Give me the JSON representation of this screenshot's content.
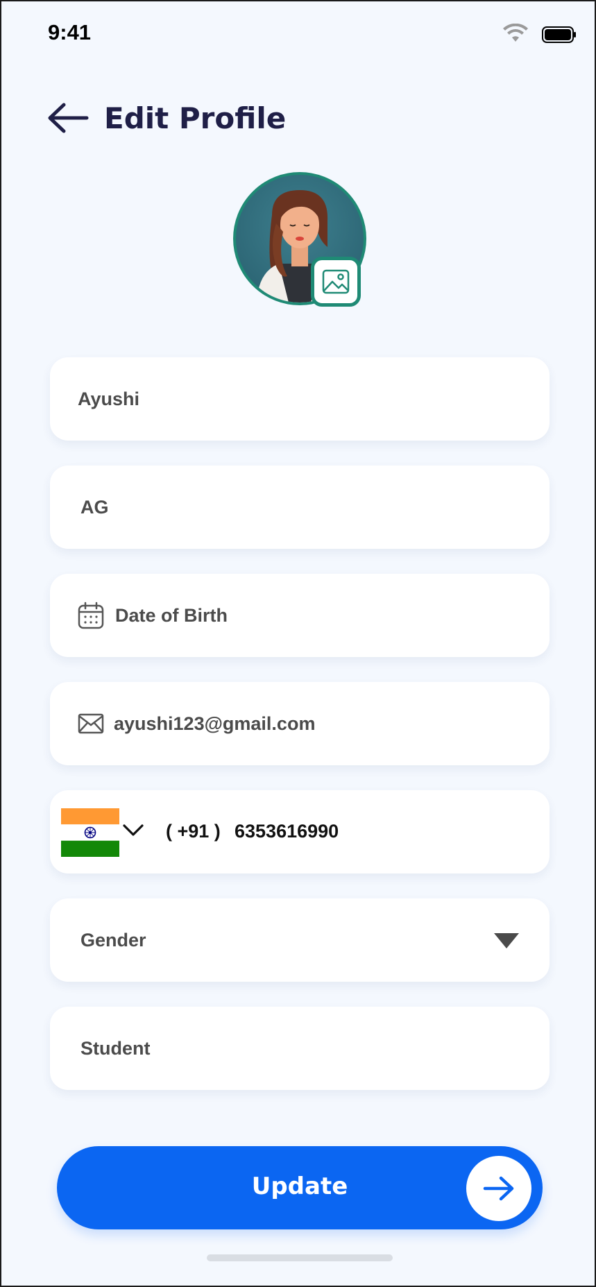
{
  "status_bar": {
    "time": "9:41",
    "icons": [
      "wifi-icon",
      "battery-icon"
    ]
  },
  "header": {
    "title": "Edit Profile",
    "back_icon": "arrow-left-icon"
  },
  "avatar": {
    "edit_icon": "image-icon"
  },
  "form": {
    "first_name": {
      "value": "Ayushi"
    },
    "last_name": {
      "value": "AG"
    },
    "date_of_birth": {
      "placeholder": "Date of Birth",
      "icon": "calendar-icon"
    },
    "email": {
      "value": "ayushi123@gmail.com",
      "icon": "envelope-icon"
    },
    "phone": {
      "country_code": "( +91 )",
      "number": "6353616990",
      "flag": "india-flag-icon"
    },
    "gender": {
      "placeholder": "Gender",
      "icon": "caret-down-icon"
    },
    "occupation": {
      "value": "Student"
    }
  },
  "actions": {
    "update_label": "Update",
    "update_icon": "arrow-right-icon"
  },
  "colors": {
    "background": "#F4F8FE",
    "primary": "#0B66F2",
    "title": "#1F1F47",
    "accent_teal": "#1F8A75",
    "field_text": "#4B4B4B"
  }
}
